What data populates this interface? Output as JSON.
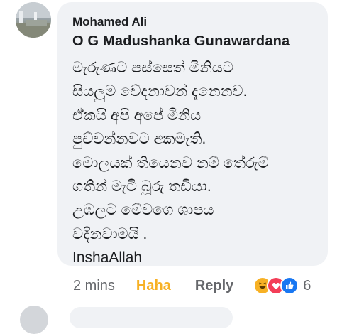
{
  "comment": {
    "author": "Mohamed Ali",
    "mention": "O G Madushanka Gunawardana",
    "body_lines": [
      "මැරුණට පස්සෙත් මිනියට",
      "සියලුම වේදනාවන් දැනෙනව.",
      "ඒකයි අපි අපේ මිනිය",
      "පුච්චන්නවට අකමැති.",
      "මොලයක් තියෙනව නම් තේරුම්",
      "ගතින් මැටි බූරු තඩියා.",
      "උඹලට මේවගෙ ශාපය",
      "වදිනවාමයි .",
      "InshaAllah"
    ]
  },
  "actions": {
    "time": "2 mins",
    "reaction_label": "Haha",
    "reply_label": "Reply",
    "reaction_count": "6"
  },
  "reactions": [
    {
      "icon": "haha-icon",
      "color": "#f7b125"
    },
    {
      "icon": "love-icon",
      "color": "#f33e58"
    },
    {
      "icon": "like-icon",
      "color": "#1877f2"
    }
  ],
  "colors": {
    "bubble": "#f0f2f5",
    "text": "#1c1e21",
    "meta": "#65676b",
    "haha": "#f7b125"
  }
}
